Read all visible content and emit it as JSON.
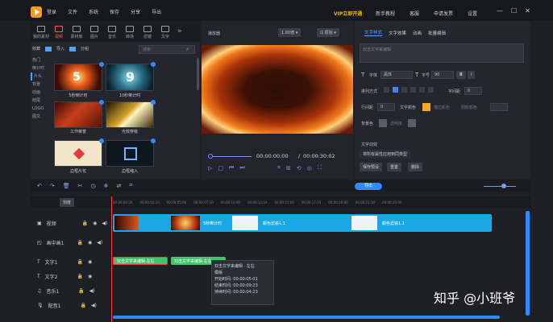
{
  "topbar": {
    "menu": [
      "登录",
      "文件",
      "系统",
      "保存",
      "分享",
      "导出"
    ],
    "vip": "VIP立即开通",
    "right_menu": [
      "新手教程",
      "客服",
      "申请发票",
      "设置"
    ]
  },
  "left": {
    "categories": [
      "我的素材",
      "视频",
      "素材库",
      "图片",
      "音乐",
      "转场",
      "滤镜",
      "文字"
    ],
    "nav": [
      "收藏",
      "导入",
      "分组"
    ],
    "search_placeholder": "搜索",
    "subnav": [
      "热门",
      "倒计时",
      "片头",
      "背景",
      "动画",
      "结尾",
      "LOGO",
      "图文"
    ],
    "thumbs": [
      "5秒倒计时",
      "10秒倒计时",
      "工作荣誉",
      "光效穿梭",
      "边框片花",
      "边框缩入"
    ]
  },
  "preview": {
    "title": "播放器",
    "zoom": "1.00倍",
    "ratio": "原始",
    "time_current": "00:00:00:00",
    "time_total": "00:00:30:02"
  },
  "right": {
    "tabs": [
      "文字样式",
      "文字效果",
      "动画",
      "批量编辑"
    ],
    "placeholder": "双击文字来编辑",
    "font_label": "字体",
    "font_value": "黑体",
    "size_label": "字号",
    "size_value": "90",
    "bold": "B",
    "italic": "I",
    "align_label": "排列方式",
    "spacing_label": "字间距",
    "spacing_value": "0",
    "line_label": "行间距",
    "line_value": "0",
    "color_label": "文字颜色",
    "stroke_label": "描边颜色",
    "shadow_label": "阴影颜色",
    "bg_label": "背景色",
    "bg_alpha_label": "透明度",
    "effect_label": "文字动效",
    "apply_all": "将所有属性应用到同类型",
    "btn_save": "保存预设",
    "btn_restore": "重置",
    "btn_delete": "删除"
  },
  "timeline": {
    "tools": [
      "撤销",
      "重做",
      "删除",
      "分割",
      "变速",
      "定格",
      "倒放",
      "裁剪"
    ],
    "export": "导出",
    "scale_label": "刻度",
    "ticks": [
      "00:00:00:00",
      "00:00:02:10",
      "00:00:05:00",
      "00:00:07:10",
      "00:00:10:00",
      "00:00:12:10",
      "00:00:15:00",
      "00:00:17:10",
      "00:00:20:00",
      "00:00:22:10",
      "00:00:25:00",
      "00:00:27:10",
      "00:00:30:00",
      "00:00:32:10"
    ],
    "tracks": [
      "视频",
      "画中画1",
      "文字1",
      "文字2",
      "音乐1",
      "配音1"
    ],
    "clips": [
      "5秒倒计时",
      "颜色滤镜1.1",
      "颜色滤镜1.1"
    ],
    "text_clips": [
      "双击文字来编辑·左右",
      "双击文字来编辑·左右"
    ],
    "tooltip": {
      "line1": "双击文字来编辑 · 左右",
      "line2": "模版",
      "line3": "开始时间: 00:00:05:01",
      "line4": "结束时间: 00:00:09:23",
      "line5": "持续时间: 00:00:04:23"
    }
  },
  "watermark": "知乎 @小班爷"
}
